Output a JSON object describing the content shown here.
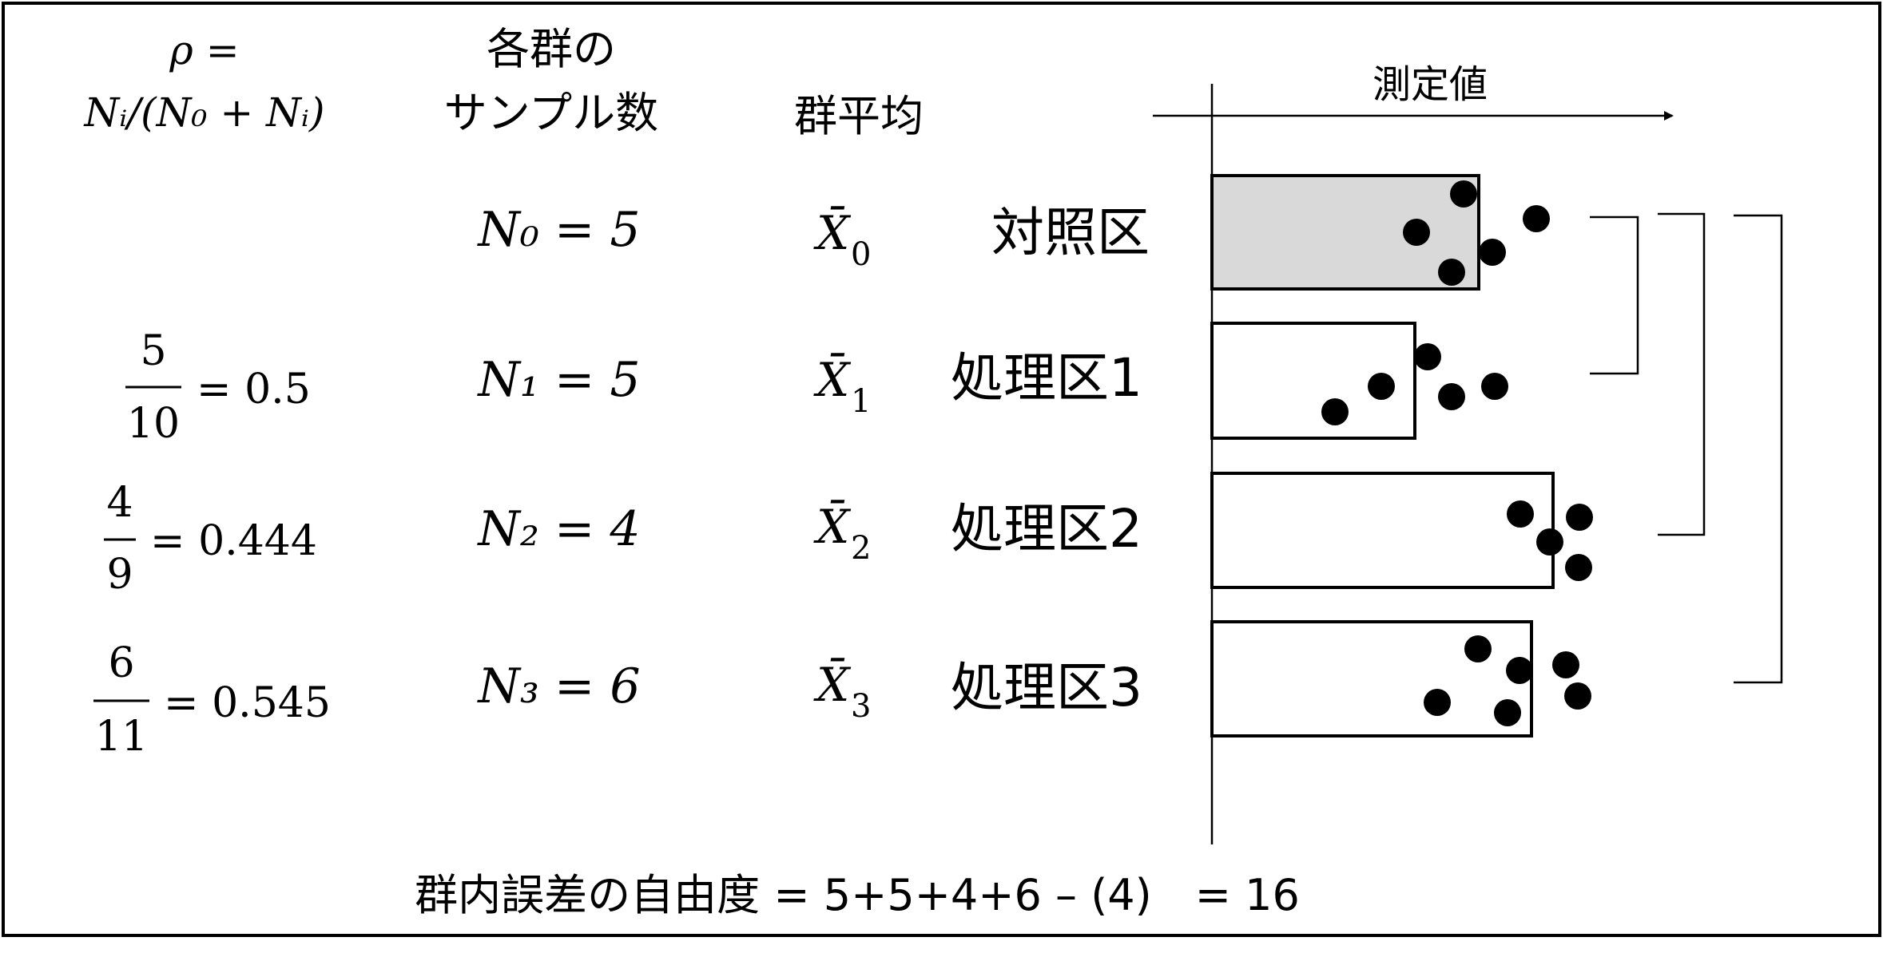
{
  "headers": {
    "rho_line1": "ρ =",
    "rho_line2": "Nᵢ/(N₀ + Nᵢ)",
    "sample_line1": "各群の",
    "sample_line2": "サンプル数",
    "mean": "群平均",
    "axis_label": "測定値"
  },
  "rows": [
    {
      "n_label": "N₀ = 5",
      "mean_sym": "X̄",
      "mean_sub": "0",
      "group": "対照区",
      "rho_num": "",
      "rho_den": "",
      "rho_val": "",
      "filled": true,
      "count": 5,
      "relative_value": 0.59
    },
    {
      "n_label": "N₁ = 5",
      "mean_sym": "X̄",
      "mean_sub": "1",
      "group": "処理区1",
      "rho_num": "5",
      "rho_den": "10",
      "rho_val": "= 0.5",
      "filled": false,
      "count": 5,
      "relative_value": 0.45
    },
    {
      "n_label": "N₂ = 4",
      "mean_sym": "X̄",
      "mean_sub": "2",
      "group": "処理区2",
      "rho_num": "4",
      "rho_den": "9",
      "rho_val": "= 0.444",
      "filled": false,
      "count": 4,
      "relative_value": 0.75
    },
    {
      "n_label": "N₃ = 6",
      "mean_sym": "X̄",
      "mean_sub": "3",
      "group": "処理区3",
      "rho_num": "6",
      "rho_den": "11",
      "rho_val": "= 0.545",
      "filled": false,
      "count": 6,
      "relative_value": 0.7
    }
  ],
  "footer": "群内誤差の自由度 = 5+5+4+6 – (4)　= 16",
  "colors": {
    "control_fill": "#d9d9d9",
    "ink": "#000000"
  }
}
